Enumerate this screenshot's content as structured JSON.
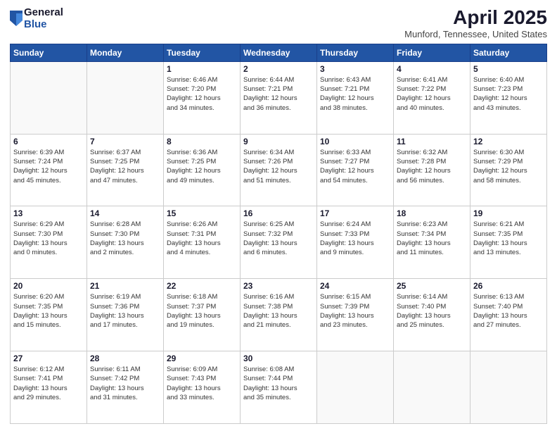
{
  "header": {
    "logo_general": "General",
    "logo_blue": "Blue",
    "title": "April 2025",
    "location": "Munford, Tennessee, United States"
  },
  "weekdays": [
    "Sunday",
    "Monday",
    "Tuesday",
    "Wednesday",
    "Thursday",
    "Friday",
    "Saturday"
  ],
  "weeks": [
    [
      {
        "day": "",
        "detail": ""
      },
      {
        "day": "",
        "detail": ""
      },
      {
        "day": "1",
        "detail": "Sunrise: 6:46 AM\nSunset: 7:20 PM\nDaylight: 12 hours\nand 34 minutes."
      },
      {
        "day": "2",
        "detail": "Sunrise: 6:44 AM\nSunset: 7:21 PM\nDaylight: 12 hours\nand 36 minutes."
      },
      {
        "day": "3",
        "detail": "Sunrise: 6:43 AM\nSunset: 7:21 PM\nDaylight: 12 hours\nand 38 minutes."
      },
      {
        "day": "4",
        "detail": "Sunrise: 6:41 AM\nSunset: 7:22 PM\nDaylight: 12 hours\nand 40 minutes."
      },
      {
        "day": "5",
        "detail": "Sunrise: 6:40 AM\nSunset: 7:23 PM\nDaylight: 12 hours\nand 43 minutes."
      }
    ],
    [
      {
        "day": "6",
        "detail": "Sunrise: 6:39 AM\nSunset: 7:24 PM\nDaylight: 12 hours\nand 45 minutes."
      },
      {
        "day": "7",
        "detail": "Sunrise: 6:37 AM\nSunset: 7:25 PM\nDaylight: 12 hours\nand 47 minutes."
      },
      {
        "day": "8",
        "detail": "Sunrise: 6:36 AM\nSunset: 7:25 PM\nDaylight: 12 hours\nand 49 minutes."
      },
      {
        "day": "9",
        "detail": "Sunrise: 6:34 AM\nSunset: 7:26 PM\nDaylight: 12 hours\nand 51 minutes."
      },
      {
        "day": "10",
        "detail": "Sunrise: 6:33 AM\nSunset: 7:27 PM\nDaylight: 12 hours\nand 54 minutes."
      },
      {
        "day": "11",
        "detail": "Sunrise: 6:32 AM\nSunset: 7:28 PM\nDaylight: 12 hours\nand 56 minutes."
      },
      {
        "day": "12",
        "detail": "Sunrise: 6:30 AM\nSunset: 7:29 PM\nDaylight: 12 hours\nand 58 minutes."
      }
    ],
    [
      {
        "day": "13",
        "detail": "Sunrise: 6:29 AM\nSunset: 7:30 PM\nDaylight: 13 hours\nand 0 minutes."
      },
      {
        "day": "14",
        "detail": "Sunrise: 6:28 AM\nSunset: 7:30 PM\nDaylight: 13 hours\nand 2 minutes."
      },
      {
        "day": "15",
        "detail": "Sunrise: 6:26 AM\nSunset: 7:31 PM\nDaylight: 13 hours\nand 4 minutes."
      },
      {
        "day": "16",
        "detail": "Sunrise: 6:25 AM\nSunset: 7:32 PM\nDaylight: 13 hours\nand 6 minutes."
      },
      {
        "day": "17",
        "detail": "Sunrise: 6:24 AM\nSunset: 7:33 PM\nDaylight: 13 hours\nand 9 minutes."
      },
      {
        "day": "18",
        "detail": "Sunrise: 6:23 AM\nSunset: 7:34 PM\nDaylight: 13 hours\nand 11 minutes."
      },
      {
        "day": "19",
        "detail": "Sunrise: 6:21 AM\nSunset: 7:35 PM\nDaylight: 13 hours\nand 13 minutes."
      }
    ],
    [
      {
        "day": "20",
        "detail": "Sunrise: 6:20 AM\nSunset: 7:35 PM\nDaylight: 13 hours\nand 15 minutes."
      },
      {
        "day": "21",
        "detail": "Sunrise: 6:19 AM\nSunset: 7:36 PM\nDaylight: 13 hours\nand 17 minutes."
      },
      {
        "day": "22",
        "detail": "Sunrise: 6:18 AM\nSunset: 7:37 PM\nDaylight: 13 hours\nand 19 minutes."
      },
      {
        "day": "23",
        "detail": "Sunrise: 6:16 AM\nSunset: 7:38 PM\nDaylight: 13 hours\nand 21 minutes."
      },
      {
        "day": "24",
        "detail": "Sunrise: 6:15 AM\nSunset: 7:39 PM\nDaylight: 13 hours\nand 23 minutes."
      },
      {
        "day": "25",
        "detail": "Sunrise: 6:14 AM\nSunset: 7:40 PM\nDaylight: 13 hours\nand 25 minutes."
      },
      {
        "day": "26",
        "detail": "Sunrise: 6:13 AM\nSunset: 7:40 PM\nDaylight: 13 hours\nand 27 minutes."
      }
    ],
    [
      {
        "day": "27",
        "detail": "Sunrise: 6:12 AM\nSunset: 7:41 PM\nDaylight: 13 hours\nand 29 minutes."
      },
      {
        "day": "28",
        "detail": "Sunrise: 6:11 AM\nSunset: 7:42 PM\nDaylight: 13 hours\nand 31 minutes."
      },
      {
        "day": "29",
        "detail": "Sunrise: 6:09 AM\nSunset: 7:43 PM\nDaylight: 13 hours\nand 33 minutes."
      },
      {
        "day": "30",
        "detail": "Sunrise: 6:08 AM\nSunset: 7:44 PM\nDaylight: 13 hours\nand 35 minutes."
      },
      {
        "day": "",
        "detail": ""
      },
      {
        "day": "",
        "detail": ""
      },
      {
        "day": "",
        "detail": ""
      }
    ]
  ]
}
